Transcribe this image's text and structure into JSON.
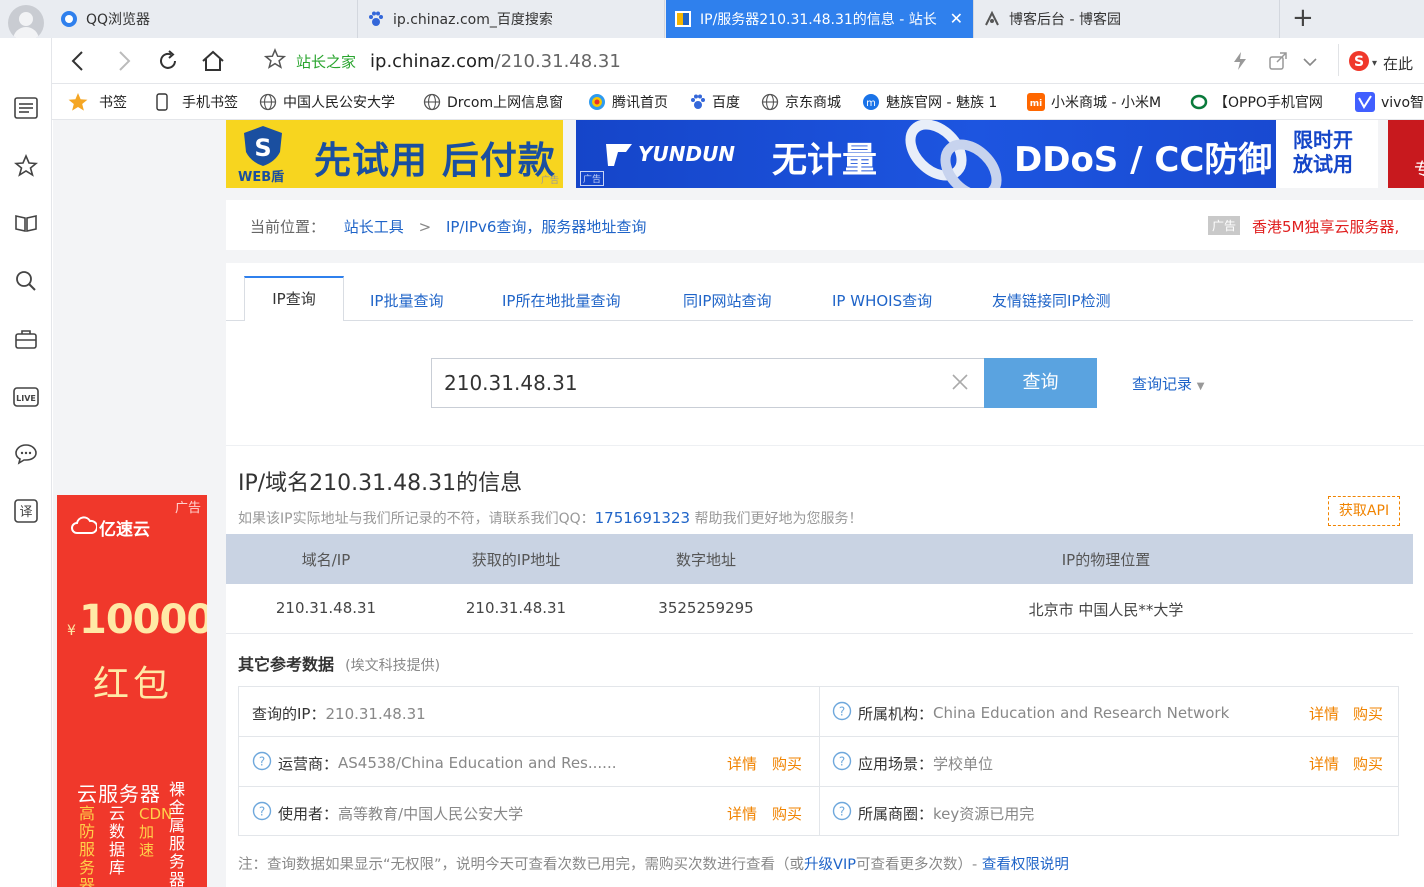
{
  "browser": {
    "avatar": "user-avatar",
    "tabs": [
      {
        "title": "QQ浏览器",
        "icon": "qq-browser-icon",
        "active": false
      },
      {
        "title": "ip.chinaz.com_百度搜索",
        "icon": "baidu-paw-icon",
        "active": false
      },
      {
        "title": "IP/服务器210.31.48.31的信息 - 站长",
        "icon": "chinaz-icon",
        "active": true
      },
      {
        "title": "博客后台 - 博客园",
        "icon": "cnblogs-icon",
        "active": false
      }
    ],
    "new_tab": "+",
    "site_label": "站长之家",
    "url_host": "ip.chinaz.com",
    "url_path": "/210.31.48.31",
    "right_label": "在此",
    "bookmarks": [
      {
        "label": "书签",
        "icon": "star-icon"
      },
      {
        "label": "手机书签",
        "icon": "phone-icon"
      },
      {
        "label": "中国人民公安大学",
        "icon": "globe-icon"
      },
      {
        "label": "Drcom上网信息窗",
        "icon": "globe-icon"
      },
      {
        "label": "腾讯首页",
        "icon": "tencent-icon"
      },
      {
        "label": "百度",
        "icon": "baidu-paw-icon"
      },
      {
        "label": "京东商城",
        "icon": "globe-icon"
      },
      {
        "label": "魅族官网 - 魅族 1",
        "icon": "meizu-icon"
      },
      {
        "label": "小米商城 - 小米M",
        "icon": "mi-icon"
      },
      {
        "label": "【OPPO手机官网",
        "icon": "oppo-icon"
      },
      {
        "label": "vivo智",
        "icon": "vivo-icon"
      }
    ]
  },
  "ads": {
    "webdun_brand": "WEB盾",
    "webdun_text": "先试用 后付款",
    "ad_tag": "广告",
    "yundun_brand": "YUNDUN",
    "yundun_text1": "无计量",
    "yundun_text2": "DDoS / CC防御",
    "yundun_badge": "限时开放试用",
    "right_edge_char": "专",
    "side_brand": "亿速云",
    "side_amount": "10000",
    "side_currency": "¥",
    "side_redpack": "红包",
    "side_title": "云服务器",
    "side_col1": "高防服务器",
    "side_col2": "云数据库",
    "side_col3": "CDN加速",
    "side_col4": "裸金属服务器"
  },
  "breadcrumb": {
    "prefix": "当前位置：",
    "item1": "站长工具",
    "sep": ">",
    "item2": "IP/IPv6查询，服务器地址查询",
    "ad_tag": "广告",
    "ad_text": "香港5M独享云服务器,"
  },
  "tabs": [
    "IP查询",
    "IP批量查询",
    "IP所在地批量查询",
    "同IP网站查询",
    "IP WHOIS查询",
    "友情链接同IP检测"
  ],
  "search": {
    "value": "210.31.48.31",
    "button": "查询",
    "history": "查询记录"
  },
  "info": {
    "title": "IP/域名210.31.48.31的信息",
    "notice_pre": "如果该IP实际地址与我们所记录的不符，请联系我们QQ：",
    "qq": "1751691323",
    "notice_post": " 帮助我们更好地为您服务！",
    "api_button": "获取API",
    "headers": [
      "域名/IP",
      "获取的IP地址",
      "数字地址",
      "IP的物理位置"
    ],
    "rows": [
      [
        "210.31.48.31",
        "210.31.48.31",
        "3525259295",
        "北京市 中国人民**大学"
      ]
    ]
  },
  "ref": {
    "title": "其它参考数据",
    "subtitle": "(埃文科技提供)",
    "detail": "详情",
    "buy": "购买",
    "cells": [
      {
        "label": "查询的IP：",
        "value": "210.31.48.31"
      },
      {
        "label": "所属机构：",
        "value": "China Education and Research Network"
      },
      {
        "label": "运营商：",
        "value": "AS4538/China Education and Res......"
      },
      {
        "label": "应用场景：",
        "value": "学校单位"
      },
      {
        "label": "使用者：",
        "value": "高等教育/中国人民公安大学"
      },
      {
        "label": "所属商圈：",
        "value": "key资源已用完"
      }
    ],
    "note_pre": "注：查询数据如果显示“无权限”，说明今天可查看次数已用完，需购买次数进行查看（或",
    "note_vip": "升级VIP",
    "note_mid": "可查看更多次数）- ",
    "note_link": "查看权限说明"
  },
  "colors": {
    "accent": "#2f80ed",
    "button": "#5aa3e0",
    "header_row": "#c9d3e3",
    "orange": "#f08300",
    "red_ad": "#f0382b"
  }
}
